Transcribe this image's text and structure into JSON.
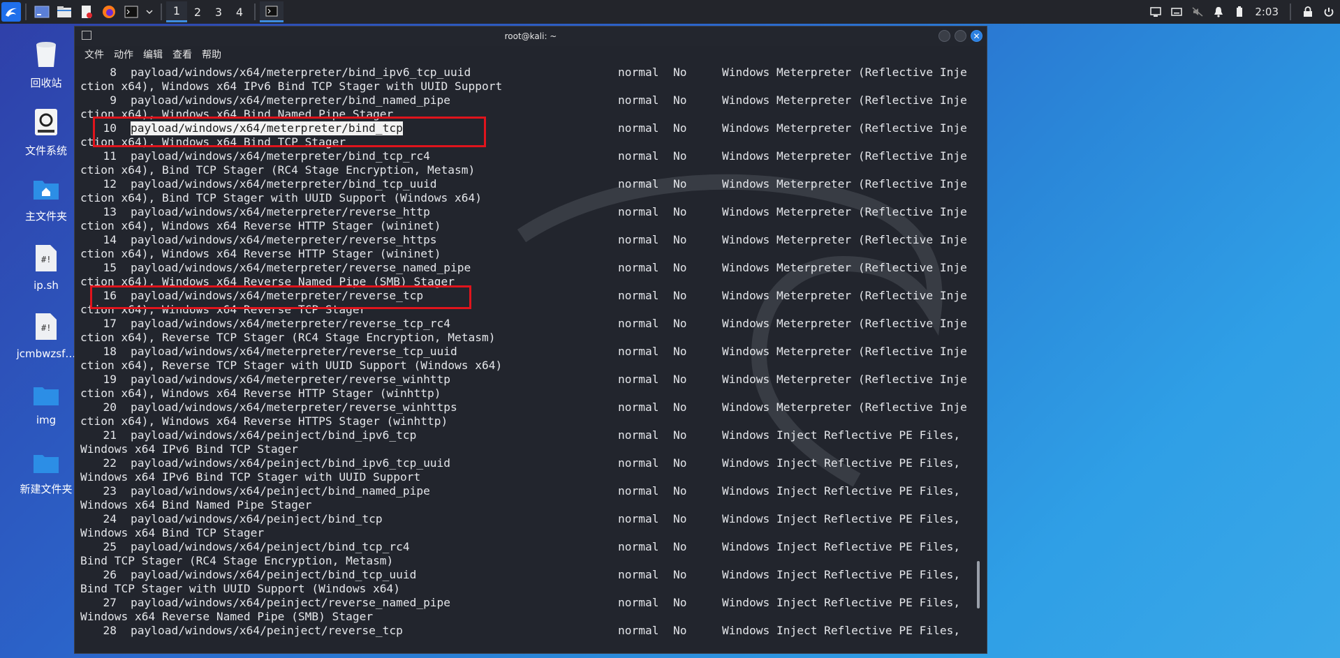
{
  "panel": {
    "workspaces": [
      "1",
      "2",
      "3",
      "4"
    ],
    "active_workspace": "1",
    "clock": "2:03"
  },
  "desktop": {
    "icons": [
      {
        "label": "回收站",
        "icon": "trash-icon"
      },
      {
        "label": "文件系统",
        "icon": "drive-icon"
      },
      {
        "label": "主文件夹",
        "icon": "home-folder-icon"
      },
      {
        "label": "ip.sh",
        "icon": "script-file-icon"
      },
      {
        "label": "jcmbwzsf…",
        "icon": "script-file-icon"
      },
      {
        "label": "img",
        "icon": "folder-icon"
      },
      {
        "label": "新建文件夹",
        "icon": "folder-icon"
      }
    ]
  },
  "window": {
    "title": "root@kali: ~",
    "menu": [
      "文件",
      "动作",
      "编辑",
      "查看",
      "帮助"
    ]
  },
  "terminal": {
    "rows": [
      {
        "num": "8",
        "name": "payload/windows/x64/meterpreter/bind_ipv6_tcp_uuid",
        "rank": "normal",
        "check": "No",
        "desc": "Windows Meterpreter (Reflective Inje",
        "cont": "ction x64), Windows x64 IPv6 Bind TCP Stager with UUID Support"
      },
      {
        "num": "9",
        "name": "payload/windows/x64/meterpreter/bind_named_pipe",
        "rank": "normal",
        "check": "No",
        "desc": "Windows Meterpreter (Reflective Inje",
        "cont": "ction x64), Windows x64 Bind Named Pipe Stager"
      },
      {
        "num": "10",
        "name": "payload/windows/x64/meterpreter/bind_tcp",
        "rank": "normal",
        "check": "No",
        "desc": "Windows Meterpreter (Reflective Inje",
        "cont": "ction x64), Windows x64 Bind TCP Stager"
      },
      {
        "num": "11",
        "name": "payload/windows/x64/meterpreter/bind_tcp_rc4",
        "rank": "normal",
        "check": "No",
        "desc": "Windows Meterpreter (Reflective Inje",
        "cont": "ction x64), Bind TCP Stager (RC4 Stage Encryption, Metasm)"
      },
      {
        "num": "12",
        "name": "payload/windows/x64/meterpreter/bind_tcp_uuid",
        "rank": "normal",
        "check": "No",
        "desc": "Windows Meterpreter (Reflective Inje",
        "cont": "ction x64), Bind TCP Stager with UUID Support (Windows x64)"
      },
      {
        "num": "13",
        "name": "payload/windows/x64/meterpreter/reverse_http",
        "rank": "normal",
        "check": "No",
        "desc": "Windows Meterpreter (Reflective Inje",
        "cont": "ction x64), Windows x64 Reverse HTTP Stager (wininet)"
      },
      {
        "num": "14",
        "name": "payload/windows/x64/meterpreter/reverse_https",
        "rank": "normal",
        "check": "No",
        "desc": "Windows Meterpreter (Reflective Inje",
        "cont": "ction x64), Windows x64 Reverse HTTP Stager (wininet)"
      },
      {
        "num": "15",
        "name": "payload/windows/x64/meterpreter/reverse_named_pipe",
        "rank": "normal",
        "check": "No",
        "desc": "Windows Meterpreter (Reflective Inje",
        "cont": "ction x64), Windows x64 Reverse Named Pipe (SMB) Stager"
      },
      {
        "num": "16",
        "name": "payload/windows/x64/meterpreter/reverse_tcp",
        "rank": "normal",
        "check": "No",
        "desc": "Windows Meterpreter (Reflective Inje",
        "cont": "ction x64), Windows x64 Reverse TCP Stager"
      },
      {
        "num": "17",
        "name": "payload/windows/x64/meterpreter/reverse_tcp_rc4",
        "rank": "normal",
        "check": "No",
        "desc": "Windows Meterpreter (Reflective Inje",
        "cont": "ction x64), Reverse TCP Stager (RC4 Stage Encryption, Metasm)"
      },
      {
        "num": "18",
        "name": "payload/windows/x64/meterpreter/reverse_tcp_uuid",
        "rank": "normal",
        "check": "No",
        "desc": "Windows Meterpreter (Reflective Inje",
        "cont": "ction x64), Reverse TCP Stager with UUID Support (Windows x64)"
      },
      {
        "num": "19",
        "name": "payload/windows/x64/meterpreter/reverse_winhttp",
        "rank": "normal",
        "check": "No",
        "desc": "Windows Meterpreter (Reflective Inje",
        "cont": "ction x64), Windows x64 Reverse HTTP Stager (winhttp)"
      },
      {
        "num": "20",
        "name": "payload/windows/x64/meterpreter/reverse_winhttps",
        "rank": "normal",
        "check": "No",
        "desc": "Windows Meterpreter (Reflective Inje",
        "cont": "ction x64), Windows x64 Reverse HTTPS Stager (winhttp)"
      },
      {
        "num": "21",
        "name": "payload/windows/x64/peinject/bind_ipv6_tcp",
        "rank": "normal",
        "check": "No",
        "desc": "Windows Inject Reflective PE Files,",
        "cont": "Windows x64 IPv6 Bind TCP Stager"
      },
      {
        "num": "22",
        "name": "payload/windows/x64/peinject/bind_ipv6_tcp_uuid",
        "rank": "normal",
        "check": "No",
        "desc": "Windows Inject Reflective PE Files,",
        "cont": "Windows x64 IPv6 Bind TCP Stager with UUID Support"
      },
      {
        "num": "23",
        "name": "payload/windows/x64/peinject/bind_named_pipe",
        "rank": "normal",
        "check": "No",
        "desc": "Windows Inject Reflective PE Files,",
        "cont": "Windows x64 Bind Named Pipe Stager"
      },
      {
        "num": "24",
        "name": "payload/windows/x64/peinject/bind_tcp",
        "rank": "normal",
        "check": "No",
        "desc": "Windows Inject Reflective PE Files,",
        "cont": "Windows x64 Bind TCP Stager"
      },
      {
        "num": "25",
        "name": "payload/windows/x64/peinject/bind_tcp_rc4",
        "rank": "normal",
        "check": "No",
        "desc": "Windows Inject Reflective PE Files,",
        "cont": "Bind TCP Stager (RC4 Stage Encryption, Metasm)"
      },
      {
        "num": "26",
        "name": "payload/windows/x64/peinject/bind_tcp_uuid",
        "rank": "normal",
        "check": "No",
        "desc": "Windows Inject Reflective PE Files,",
        "cont": "Bind TCP Stager with UUID Support (Windows x64)"
      },
      {
        "num": "27",
        "name": "payload/windows/x64/peinject/reverse_named_pipe",
        "rank": "normal",
        "check": "No",
        "desc": "Windows Inject Reflective PE Files,",
        "cont": "Windows x64 Reverse Named Pipe (SMB) Stager"
      },
      {
        "num": "28",
        "name": "payload/windows/x64/peinject/reverse_tcp",
        "rank": "normal",
        "check": "No",
        "desc": "Windows Inject Reflective PE Files,",
        "cont": ""
      }
    ]
  },
  "colors": {
    "highlight_box": "#e0141c",
    "terminal_bg": "#22252d",
    "accent": "#3e8de0"
  }
}
